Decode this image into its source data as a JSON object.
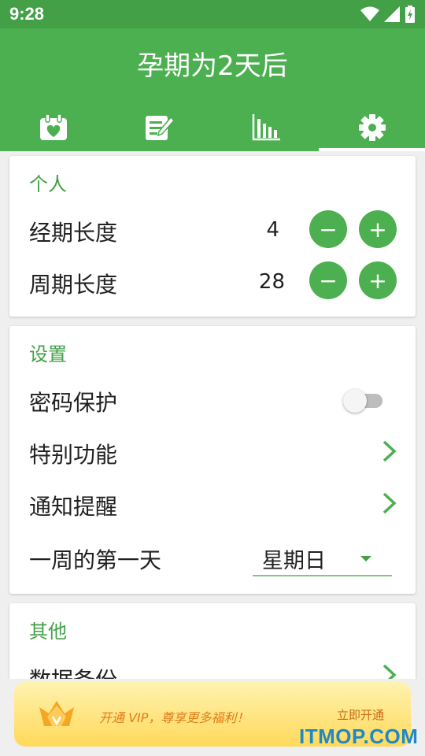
{
  "status_bar": {
    "time": "9:28"
  },
  "app_bar": {
    "title": "孕期为2天后"
  },
  "tabs": [
    {
      "icon": "calendar-heart-icon"
    },
    {
      "icon": "notes-edit-icon"
    },
    {
      "icon": "bar-chart-icon"
    },
    {
      "icon": "gear-icon",
      "active": true
    }
  ],
  "personal": {
    "title": "个人",
    "period_length": {
      "label": "经期长度",
      "value": "4"
    },
    "cycle_length": {
      "label": "周期长度",
      "value": "28"
    },
    "minus": "−",
    "plus": "+"
  },
  "settings": {
    "title": "设置",
    "password": {
      "label": "密码保护",
      "enabled": false
    },
    "special": {
      "label": "特别功能"
    },
    "notify": {
      "label": "通知提醒"
    },
    "first_day": {
      "label": "一周的第一天",
      "value": "星期日"
    }
  },
  "other": {
    "title": "其他",
    "backup": {
      "label": "数据备份"
    }
  },
  "vip_banner": {
    "text": "开通 VIP，尊享更多福利！",
    "action": "立即开通"
  },
  "watermark": "ITMOP.COM",
  "colors": {
    "primary": "#4caf50",
    "status": "#43a047",
    "accent_text": "#43a047"
  }
}
